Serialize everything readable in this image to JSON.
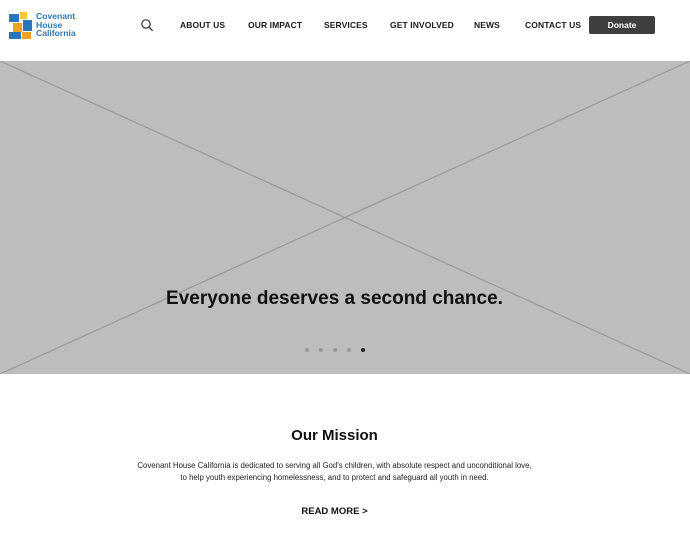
{
  "brand": {
    "logo_lines": [
      "Covenant",
      "House",
      "California"
    ],
    "colors": {
      "blue": "#2a77b8",
      "orange": "#f2a020",
      "yellow": "#f8c63a"
    }
  },
  "header": {
    "search_icon": "search-icon",
    "nav": [
      "ABOUT US",
      "OUR IMPACT",
      "SERVICES",
      "GET INVOLVED",
      "NEWS",
      "CONTACT US"
    ],
    "donate_label": "Donate"
  },
  "hero": {
    "headline": "Everyone deserves a second chance.",
    "slide_count": 5,
    "active_slide": 5,
    "placeholder_color": "#bdbdbd"
  },
  "mission": {
    "title": "Our Mission",
    "text_line1": "Covenant House California is dedicated to serving all God's children, with absolute respect and unconditional love,",
    "text_line2": "to help youth experiencing homelessness, and to protect and safeguard all youth in need.",
    "read_more": "READ MORE >"
  }
}
